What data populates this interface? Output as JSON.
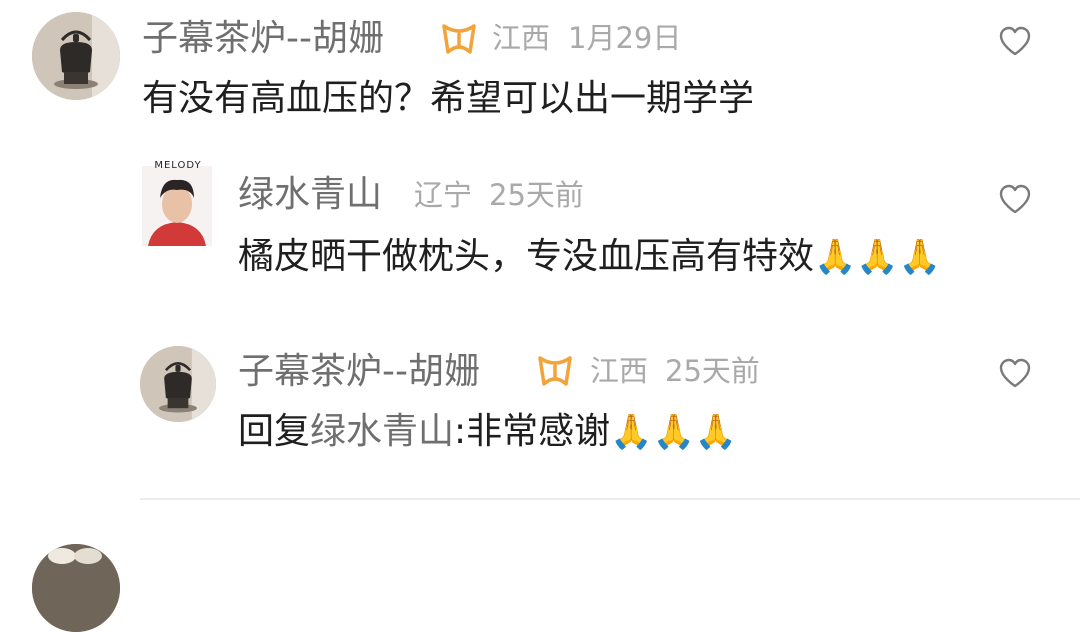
{
  "comments": [
    {
      "author": "子幕茶炉--胡姗",
      "location": "江西",
      "time": "1月29日",
      "text": "有没有高血压的？希望可以出一期学学"
    }
  ],
  "replies": [
    {
      "author": "绿水青山",
      "avatar_caption": "MELODY",
      "location": "辽宁",
      "time": "25天前",
      "text": "橘皮晒干做枕头，专没血压高有特效",
      "emoji": "🙏🙏🙏"
    },
    {
      "author": "子幕茶炉--胡姗",
      "location": "江西",
      "time": "25天前",
      "reply_prefix": "回复",
      "mention": "绿水青山",
      "text": ":非常感谢",
      "emoji": "🙏🙏🙏"
    }
  ],
  "icons": {
    "like": "heart-outline-icon",
    "badge": "orange-ribbon-badge-icon"
  },
  "colors": {
    "name": "#6f6f6f",
    "meta": "#a9a9a9",
    "text": "#1f1f1f",
    "badge": "#f2a33a"
  }
}
